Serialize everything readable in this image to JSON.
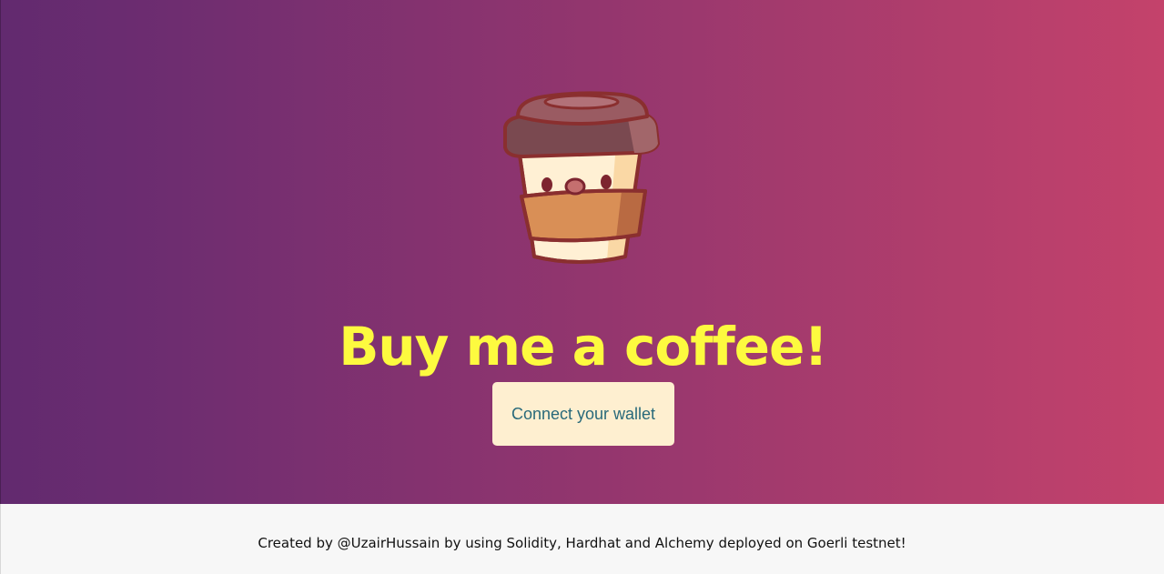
{
  "hero": {
    "logo_icon": "coffee-cup-mascot-icon",
    "title": "Buy me a coffee!",
    "connect_button_label": "Connect your wallet"
  },
  "footer": {
    "text": "Created by @UzairHussain by using Solidity, Hardhat and Alchemy deployed on Goerli testnet!"
  },
  "colors": {
    "gradient_start": "#622a6f",
    "gradient_end": "#c4426b",
    "title": "#fdfa3f",
    "button_background": "#feefd0",
    "button_text": "#28697a",
    "footer_background": "#f7f7f7"
  }
}
